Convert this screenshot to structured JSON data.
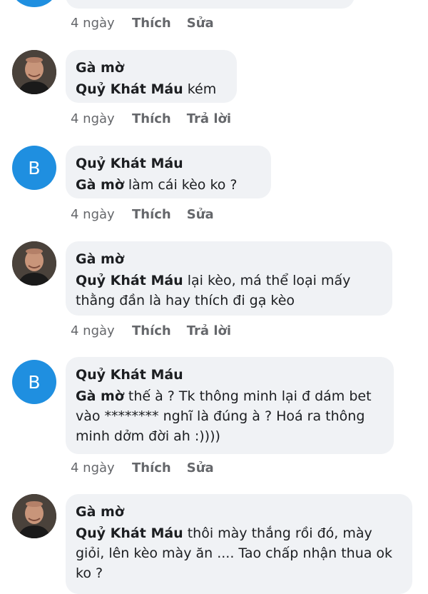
{
  "top_meta": {
    "time": "4 ngày",
    "like": "Thích",
    "action": "Sửa"
  },
  "comments": [
    {
      "author": "Gà mờ",
      "mention": "Quỷ Khát Máu",
      "text": "kém",
      "time": "4 ngày",
      "like": "Thích",
      "action": "Trả lời"
    },
    {
      "author": "Quỷ Khát Máu",
      "avatar_letter": "B",
      "mention": "Gà mờ",
      "text": "làm cái kèo ko ?",
      "time": "4 ngày",
      "like": "Thích",
      "action": "Sửa"
    },
    {
      "author": "Gà mờ",
      "mention": "Quỷ Khát Máu",
      "text": "lại kèo, má thể loại mấy thằng đần là hay thích đi gạ kèo",
      "time": "4 ngày",
      "like": "Thích",
      "action": "Trả lời"
    },
    {
      "author": "Quỷ Khát Máu",
      "avatar_letter": "B",
      "mention": "Gà mờ",
      "text": "thế à ? Tk thông minh lại đ dám bet vào ******** nghĩ là đúng à ? Hoá ra thông minh dởm đời ah :))))",
      "time": "4 ngày",
      "like": "Thích",
      "action": "Sửa"
    },
    {
      "author": "Gà mờ",
      "mention": "Quỷ Khát Máu",
      "text": "thôi mày thắng rồi đó, mày giỏi, lên kèo mày ăn .... Tao chấp nhận thua ok ko ?"
    }
  ],
  "colors": {
    "bubble": "#f0f2f5",
    "meta": "#65676b",
    "avatar_blue": "#1f8fe0"
  }
}
